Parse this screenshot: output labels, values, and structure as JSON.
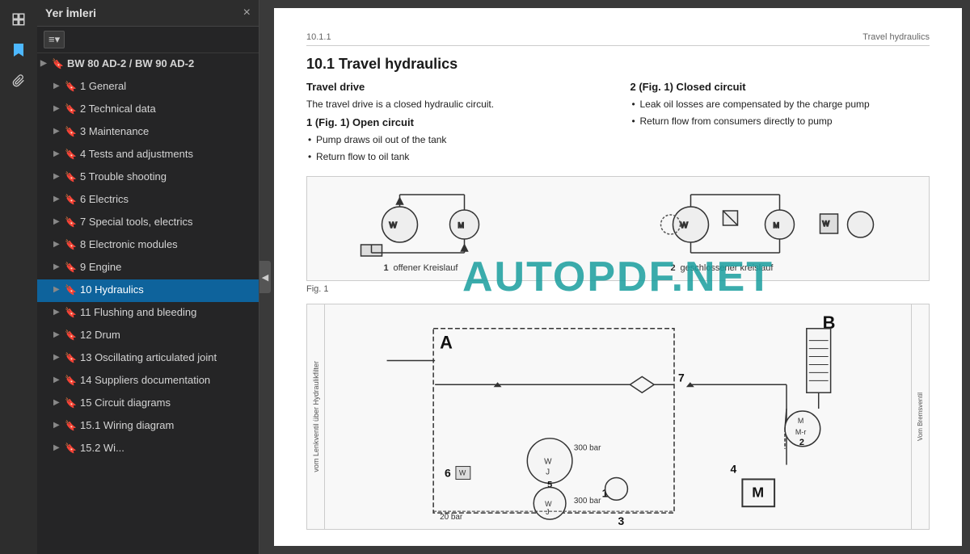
{
  "toolbar": {
    "icons": [
      "layers-icon",
      "bookmark-icon",
      "clip-icon"
    ]
  },
  "sidebar": {
    "title": "Yer İmleri",
    "close_label": "×",
    "toolbar_btn": "≡▾",
    "items": [
      {
        "id": "root",
        "label": "BW 80 AD-2 / BW 90 AD-2",
        "level": 0,
        "has_arrow": true,
        "expanded": true
      },
      {
        "id": "1",
        "label": "1 General",
        "level": 1,
        "has_arrow": true,
        "expanded": false
      },
      {
        "id": "2",
        "label": "2 Technical data",
        "level": 1,
        "has_arrow": true,
        "expanded": false
      },
      {
        "id": "3",
        "label": "3 Maintenance",
        "level": 1,
        "has_arrow": true,
        "expanded": false
      },
      {
        "id": "4",
        "label": "4 Tests and adjustments",
        "level": 1,
        "has_arrow": true,
        "expanded": false
      },
      {
        "id": "5",
        "label": "5 Trouble shooting",
        "level": 1,
        "has_arrow": true,
        "expanded": false
      },
      {
        "id": "6",
        "label": "6 Electrics",
        "level": 1,
        "has_arrow": true,
        "expanded": false
      },
      {
        "id": "7",
        "label": "7 Special tools, electrics",
        "level": 1,
        "has_arrow": true,
        "expanded": false
      },
      {
        "id": "8",
        "label": "8 Electronic modules",
        "level": 1,
        "has_arrow": true,
        "expanded": false
      },
      {
        "id": "9",
        "label": "9 Engine",
        "level": 1,
        "has_arrow": true,
        "expanded": false
      },
      {
        "id": "10",
        "label": "10 Hydraulics",
        "level": 1,
        "has_arrow": true,
        "expanded": false,
        "active": true
      },
      {
        "id": "11",
        "label": "11 Flushing and bleeding",
        "level": 1,
        "has_arrow": true,
        "expanded": false
      },
      {
        "id": "12",
        "label": "12 Drum",
        "level": 1,
        "has_arrow": true,
        "expanded": false
      },
      {
        "id": "13",
        "label": "13 Oscillating articulated joint",
        "level": 1,
        "has_arrow": true,
        "expanded": false
      },
      {
        "id": "14",
        "label": "14 Suppliers documentation",
        "level": 1,
        "has_arrow": true,
        "expanded": false
      },
      {
        "id": "15",
        "label": "15 Circuit diagrams",
        "level": 1,
        "has_arrow": true,
        "expanded": false
      },
      {
        "id": "15_1",
        "label": "15.1 Wiring diagram",
        "level": 1,
        "has_arrow": true,
        "expanded": false
      },
      {
        "id": "15_2",
        "label": "15.2 Wi...",
        "level": 1,
        "has_arrow": true,
        "expanded": false
      }
    ]
  },
  "content": {
    "page_header_left": "10.1.1",
    "page_header_right": "Travel hydraulics",
    "section_title": "10.1 Travel hydraulics",
    "subsection1_title": "Travel drive",
    "subsection1_text": "The travel drive is a closed hydraulic circuit.",
    "open_circuit_title": "1 (Fig. 1) Open circuit",
    "open_circuit_bullets": [
      "Pump draws oil out of the tank",
      "Return flow to oil tank"
    ],
    "closed_circuit_title": "2 (Fig. 1) Closed circuit",
    "closed_circuit_bullets": [
      "Leak oil losses are compensated by the charge pump",
      "Return flow from consumers directly to pump"
    ],
    "fig_label": "Fig. 1",
    "diagram_top_label1": "1 offener Kreislauf",
    "diagram_top_label2": "2 geschlossener kreislauf",
    "watermark": "AUTOPDF.NET"
  }
}
